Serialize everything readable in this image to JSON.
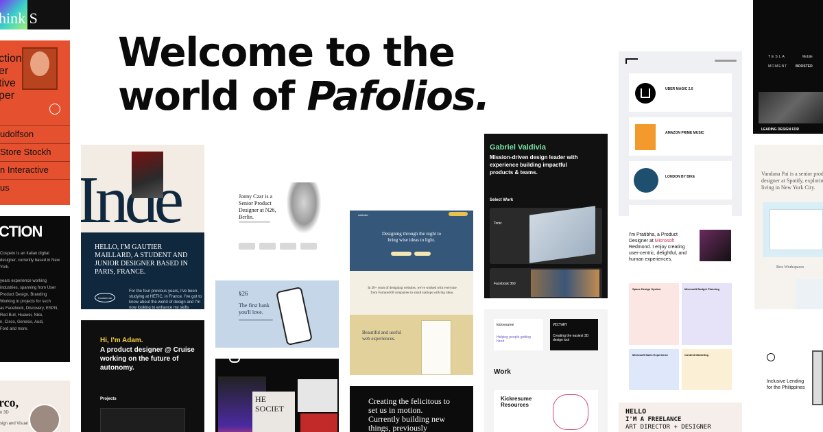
{
  "hero": {
    "line1": "Welcome to the",
    "line2_prefix": "world of ",
    "line2_em": "Pafolios."
  },
  "c1": {
    "text": "hink S"
  },
  "c2": {
    "lines": [
      "ction",
      "er",
      "tive",
      "per"
    ],
    "rows": [
      "udolfson",
      "Store Stockh",
      "n Interactive",
      "us"
    ]
  },
  "c3": {
    "title": "CTION",
    "lines": [
      "Cospeto is an Italian digital",
      "designer, currently based in New York.",
      "",
      "years experience working",
      "industries, spanning from User",
      "Product Design, Branding",
      "Working in projects for such",
      "as Facebook, Discovery, ESPN,",
      "Red Bull, Huawei, Nike,",
      "n, Cisco, Genesis, Audi,",
      "Ford and more."
    ]
  },
  "c4": {
    "lines": [
      "rco,",
      "n 3D",
      "sign and Visual"
    ]
  },
  "c5": {
    "big": "Inde",
    "intro": "HELLO, I'M GAUTIER MAILLARD, A STUDENT AND JUNIOR DESIGNER BASED IN PARIS, FRANCE.",
    "para": "For the four previous years, I've been studying at HETIC, in France. I've got to know about the world of design and I'm now looking to enhance my skills",
    "badge": "Contact me"
  },
  "c6": {
    "hi": "Hi, I'm Adam.",
    "lines": [
      "A product designer @ Cruise",
      "working on the future of",
      "autonomy."
    ],
    "projects": "Projects"
  },
  "c7": {
    "lines": [
      "Jonny Czar is a",
      "Senior Product",
      "Designer at N26,",
      "Berlin."
    ]
  },
  "c8": {
    "mark": "§26",
    "lines": [
      "The first bank",
      "you'll love."
    ]
  },
  "c10": {
    "lines": [
      "Designing through the night to",
      "bring wise ideas to light."
    ],
    "mid": "In 20+ years of designing websites, we've worked with everyone from Fortune500 companies to small startups with big ideas.",
    "bottom": [
      "Beautiful and useful",
      "web experiences."
    ]
  },
  "c11": {
    "lines": [
      "Creating the felicitous to",
      "set us in motion.",
      "Currently building new",
      "things, previously"
    ]
  },
  "c12": {
    "name": "Gabriel Valdivia",
    "lines": [
      "Mission-driven design leader with",
      "experience building impactful",
      "products & teams."
    ],
    "sel": "Select Work",
    "t1": "Tonic",
    "t2": "Facebook 360"
  },
  "c13": {
    "brand1": "kickresume",
    "brand2": "VECTARY",
    "t1": "Helping people getting hired",
    "t2": "Creating the easiest 3D design tool",
    "work": "Work",
    "kr": [
      "Kickresume",
      "Resources"
    ]
  },
  "c14": {
    "items": [
      "UBER MAGIC 2.0",
      "AMAZON PRIME MUSIC",
      "LONDON BY BIKE"
    ]
  },
  "c15": {
    "lines": [
      "I'm Pratibha, a Product",
      "Designer at ",
      "Redmond. I enjoy creating",
      "user-centric, delightful, and",
      "human experiences."
    ],
    "ms": "Microsoft",
    "tiles": [
      "Space Design System",
      "Microsoft Budget Planning",
      "Microsoft Sales Experience",
      "Content Marketing"
    ]
  },
  "c16": {
    "hello": "HELLO",
    "lines": [
      "I'M A FREELANCE",
      "ART DIRECTOR + DESIGNER"
    ]
  },
  "c17": {
    "brands": [
      "TESLA",
      "Mobile",
      "MOMENT",
      "BOOSTED"
    ],
    "caption": "LEADING DESIGN FOR"
  },
  "c18": {
    "lines": [
      "Vandana Pai is a senior product",
      "designer at Spotify, exploring and",
      "living in New York City."
    ],
    "box": "Box Workspaces"
  },
  "c19": {
    "lines": [
      "Inclusive Lending",
      "for the Philippines"
    ]
  },
  "colors": {
    "red": "#e5502f",
    "navy": "#10283d",
    "dark": "#0d0d0d",
    "green": "#79e2a4",
    "blue": "#c5d6e8"
  }
}
